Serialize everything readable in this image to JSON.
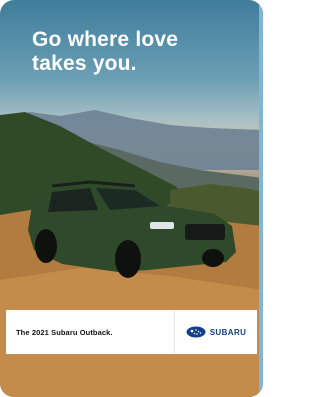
{
  "ad": {
    "headline_line1": "Go where love",
    "headline_line2": "takes you.",
    "caption": "The 2021 Subaru Outback.",
    "brand": "SUBARU"
  },
  "colors": {
    "sky": "#4a86a6",
    "car": "#2f4a2a",
    "dirt": "#b9874a",
    "brand_blue": "#123f8a"
  }
}
